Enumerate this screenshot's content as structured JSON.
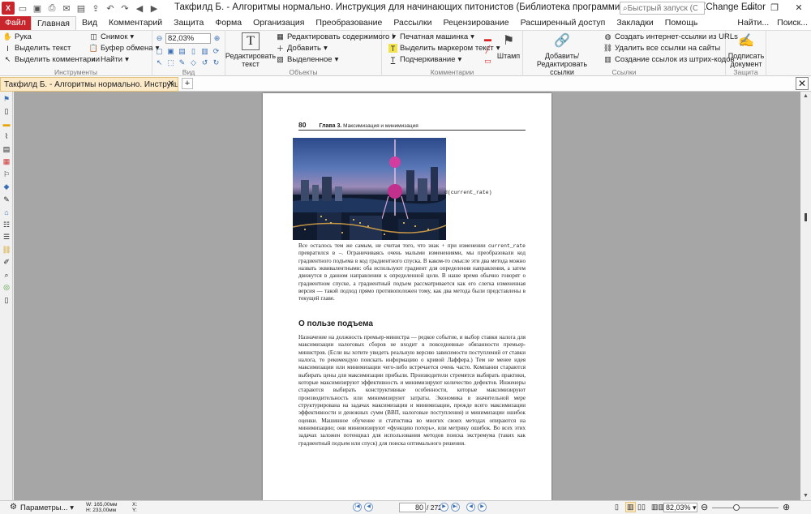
{
  "window": {
    "title": "Такфилд Б. - Алгоритмы нормально. Инструкция для начинающих питонистов (Библиотека программиста) - 2022* - PDF-XChange Editor",
    "quick_launch_placeholder": "Быстрый запуск (Ctrl+.)"
  },
  "menu": {
    "file": "Файл",
    "tabs": [
      "Главная",
      "Вид",
      "Комментарий",
      "Защита",
      "Форма",
      "Организация",
      "Преобразование",
      "Рассылки",
      "Рецензирование",
      "Расширенный доступ",
      "Закладки",
      "Помощь"
    ],
    "right": [
      "Найти...",
      "Поиск..."
    ]
  },
  "ribbon": {
    "tools": {
      "title": "Инструменты",
      "hand": "Рука",
      "select_text": "Выделить текст",
      "select_comments": "Выделить комментарии",
      "snapshot": "Снимок",
      "clipboard": "Буфер обмена",
      "find": "Найти"
    },
    "view": {
      "title": "Вид",
      "zoom": "82,03%"
    },
    "objects": {
      "title": "Объекты",
      "edit_text": "Редактировать текст",
      "edit_content": "Редактировать содержимого",
      "add": "Добавить",
      "selected": "Выделенное"
    },
    "comments": {
      "title": "Комментарии",
      "typewriter": "Печатная машинка",
      "highlight": "Выделить маркером текст",
      "underline": "Подчеркивание",
      "stamp": "Штамп"
    },
    "links": {
      "title": "Ссылки",
      "add_edit": "Добавить/Редактировать ссылки",
      "create_url": "Создать интернет-ссылки из URLs",
      "remove_all": "Удалить все ссылки на сайты",
      "barcode": "Создание ссылок из штрих-кодов"
    },
    "protect": {
      "title": "Защита",
      "sign": "Подписать документ"
    }
  },
  "doc_tab": {
    "label": "Такфилд Б. - Алгоритмы нормально. Инструкц...",
    "modified_mark": "*"
  },
  "page": {
    "number": "80",
    "chapter": "Глава 3.",
    "chapter_title": "Максимизация и минимизация",
    "code_fragment": "d(current_rate)",
    "para1": [
      "Все осталось тем же самым, не считая того, что знак + при изменении ",
      "current_rate",
      " превратился в –. Ограничиваясь очень малыми изменениями, мы преобразовали код градиентного подъема в код градиентного спуска. В каком-то смысле эти два метода можно назвать эквивалентными: оба используют градиент для определения направления, а затем движутся в данном направлении к определенной цели. В наше время обычно говорят о градиентном спуске, а градиентный подъем рассматривается как его слегка измененная версия — такой подход прямо противоположен тому, как два метода были представлены в текущей главе."
    ],
    "heading": "О пользе подъема",
    "para2": "Назначение на должность премьер-министра — редкое событие, и выбор ставки налога для максимизации налоговых сборов не входит в повседневные обязанности премьер-министров. (Если вы хотите увидеть реальную версию зависимости поступлений от ставки налога, то рекомендую поискать информацию о кривой Лаффера.) Тем не менее идея максимизации или минимизации чего-либо встречается очень часто. Компании стараются выбирать цены для максимизации прибыли. Производители стремятся выбирать практики, которые максимизируют эффективность и минимизируют количество дефектов. Инженеры стараются выбирать конструктивные особенности, которые максимизируют производительность или минимизируют затраты. Экономика в значительной мере структурирована на задачах максимизации и минимизации, прежде всего максимизации эффективности и денежных сумм (ВВП, налоговые поступления) и минимизации ошибок оценки. Машинное обучение и статистика во многих своих методах опираются на минимизацию; они минимизируют «функцию потерь», или метрику ошибок. Во всех этих задачах заложен потенциал для использования методов поиска экстремума (таких как градиентный подъем или спуск) для поиска оптимального решения."
  },
  "status": {
    "params": "Параметры...",
    "width": "W: 165,00мм",
    "height": "H: 233,00мм",
    "x": "X:",
    "y": "Y:",
    "current_page": "80",
    "page_count": "/ 272",
    "zoom": "82,03%"
  }
}
